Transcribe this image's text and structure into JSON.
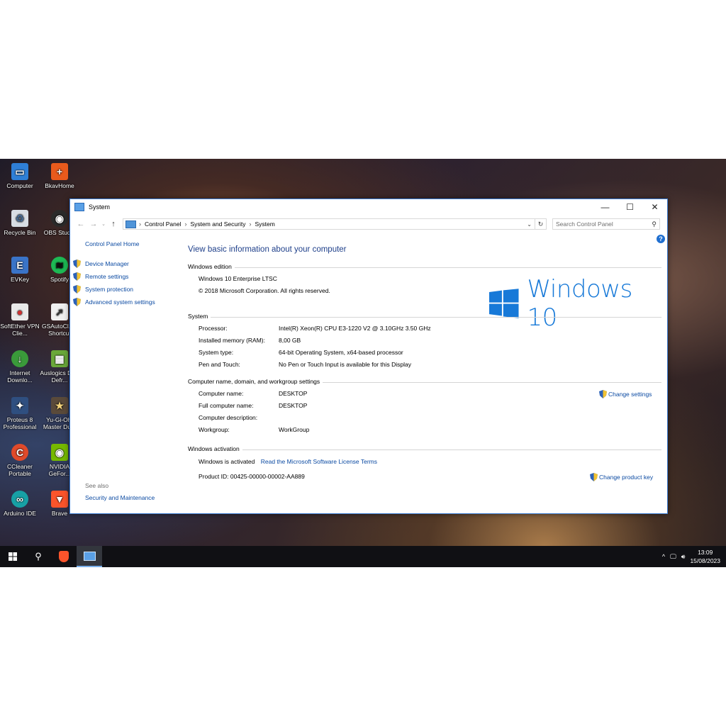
{
  "desktop_icons": [
    {
      "label": "Computer",
      "icon": "computer-icon"
    },
    {
      "label": "BkavHome",
      "icon": "bkav-icon"
    },
    {
      "label": "Recycle Bin",
      "icon": "recycle-bin-icon"
    },
    {
      "label": "OBS Studio",
      "icon": "obs-icon"
    },
    {
      "label": "EVKey",
      "icon": "evkey-icon"
    },
    {
      "label": "Spotify",
      "icon": "spotify-icon"
    },
    {
      "label": "SoftEther VPN Clie...",
      "icon": "softether-icon"
    },
    {
      "label": "GSAutoCl... - Shortcut",
      "icon": "gsautoclicker-icon"
    },
    {
      "label": "Internet Downlo...",
      "icon": "internet-download-icon"
    },
    {
      "label": "Auslogics Disk Defr...",
      "icon": "auslogics-icon"
    },
    {
      "label": "Proteus 8 Professional",
      "icon": "proteus-icon"
    },
    {
      "label": "Yu-Gi-Oh! Master Du...",
      "icon": "yugioh-icon"
    },
    {
      "label": "CCleaner Portable",
      "icon": "ccleaner-icon"
    },
    {
      "label": "NVIDIA GeFor...",
      "icon": "nvidia-icon"
    },
    {
      "label": "Arduino IDE",
      "icon": "arduino-icon"
    },
    {
      "label": "Brave",
      "icon": "brave-icon"
    }
  ],
  "window": {
    "title": "System",
    "controls": {
      "minimize": "—",
      "maximize": "☐",
      "close": "✕"
    }
  },
  "address_bar": {
    "crumbs": [
      "Control Panel",
      "System and Security",
      "System"
    ]
  },
  "search": {
    "placeholder": "Search Control Panel"
  },
  "sidebar": {
    "home": "Control Panel Home",
    "items": [
      "Device Manager",
      "Remote settings",
      "System protection",
      "Advanced system settings"
    ],
    "see_also": "See also",
    "see_also_link": "Security and Maintenance"
  },
  "main": {
    "heading": "View basic information about your computer",
    "windows_edition": {
      "title": "Windows edition",
      "edition": "Windows 10 Enterprise LTSC",
      "copyright": "© 2018 Microsoft Corporation. All rights reserved.",
      "logo_text": "Windows 10"
    },
    "system": {
      "title": "System",
      "rows": [
        {
          "label": "Processor:",
          "value": "Intel(R) Xeon(R) CPU E3-1220 V2 @ 3.10GHz   3.50 GHz"
        },
        {
          "label": "Installed memory (RAM):",
          "value": "8,00 GB"
        },
        {
          "label": "System type:",
          "value": "64-bit Operating System, x64-based processor"
        },
        {
          "label": "Pen and Touch:",
          "value": "No Pen or Touch Input is available for this Display"
        }
      ]
    },
    "computer_name": {
      "title": "Computer name, domain, and workgroup settings",
      "rows": [
        {
          "label": "Computer name:",
          "value": "DESKTOP"
        },
        {
          "label": "Full computer name:",
          "value": "DESKTOP"
        },
        {
          "label": "Computer description:",
          "value": ""
        },
        {
          "label": "Workgroup:",
          "value": "WorkGroup"
        }
      ],
      "change_settings": "Change settings"
    },
    "activation": {
      "title": "Windows activation",
      "status": "Windows is activated",
      "license_link": "Read the Microsoft Software License Terms",
      "product_id": "Product ID: 00425-00000-00002-AA889",
      "change_key": "Change product key"
    }
  },
  "taskbar": {
    "clock_time": "13:09",
    "clock_date": "15/08/2023"
  },
  "colors": {
    "link": "#0b4aa2",
    "heading": "#1e3f8a",
    "windows_blue": "#1779d8",
    "taskbar": "#101014"
  }
}
